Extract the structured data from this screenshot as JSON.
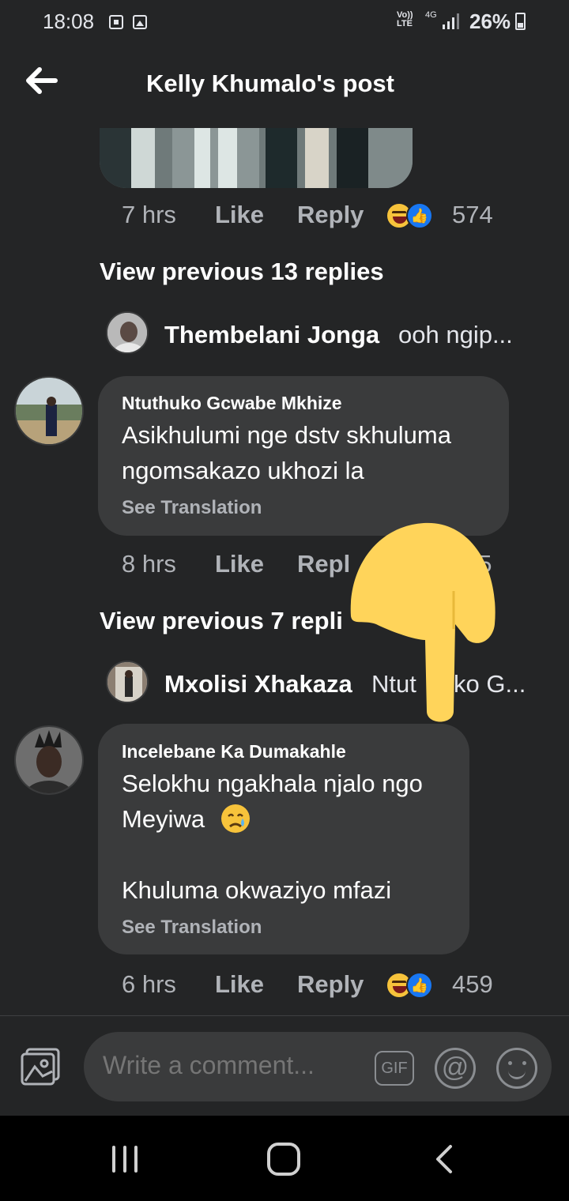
{
  "status_bar": {
    "time": "18:08",
    "network": "Vo))\nLTE",
    "network_type": "4G",
    "battery": "26%"
  },
  "header": {
    "back_icon": "arrow-left-icon",
    "title": "Kelly Khumalo's post"
  },
  "comments": [
    {
      "time": "7 hrs",
      "like_label": "Like",
      "reply_label": "Reply",
      "reactions": [
        "haha",
        "like"
      ],
      "reaction_count": "574"
    },
    {
      "view_previous": "View previous 13 replies",
      "preview_name": "Thembelani Jonga",
      "preview_text": "ooh ngip...",
      "author": "Ntuthuko Gcwabe Mkhize",
      "text_lines": [
        "Asikhulumi nge dstv skhuluma",
        "ngomsakazo ukhozi la"
      ],
      "see_translation": "See Translation",
      "time": "8 hrs",
      "like_label": "Like",
      "reply_label": "Repl",
      "reaction_count": "55"
    },
    {
      "view_previous": "View previous 7 repli",
      "preview_name": "Mxolisi Xhakaza",
      "preview_text_a": "Ntut",
      "preview_text_b": "ko G...",
      "author": "Incelebane Ka Dumakahle",
      "text_lines": [
        "Selokhu ngakhala njalo ngo",
        "Meyiwa",
        "",
        "Khuluma okwaziyo mfazi"
      ],
      "see_translation": "See Translation",
      "time": "6 hrs",
      "like_label": "Like",
      "reply_label": "Reply",
      "reactions": [
        "haha",
        "like"
      ],
      "reaction_count": "459"
    }
  ],
  "composer": {
    "placeholder": "Write a comment...",
    "gif_label": "GIF",
    "at_label": "@"
  },
  "colors": {
    "background": "#242526",
    "bubble": "#3a3b3c",
    "pointer": "#ffd45a",
    "like_blue": "#1877f2"
  }
}
